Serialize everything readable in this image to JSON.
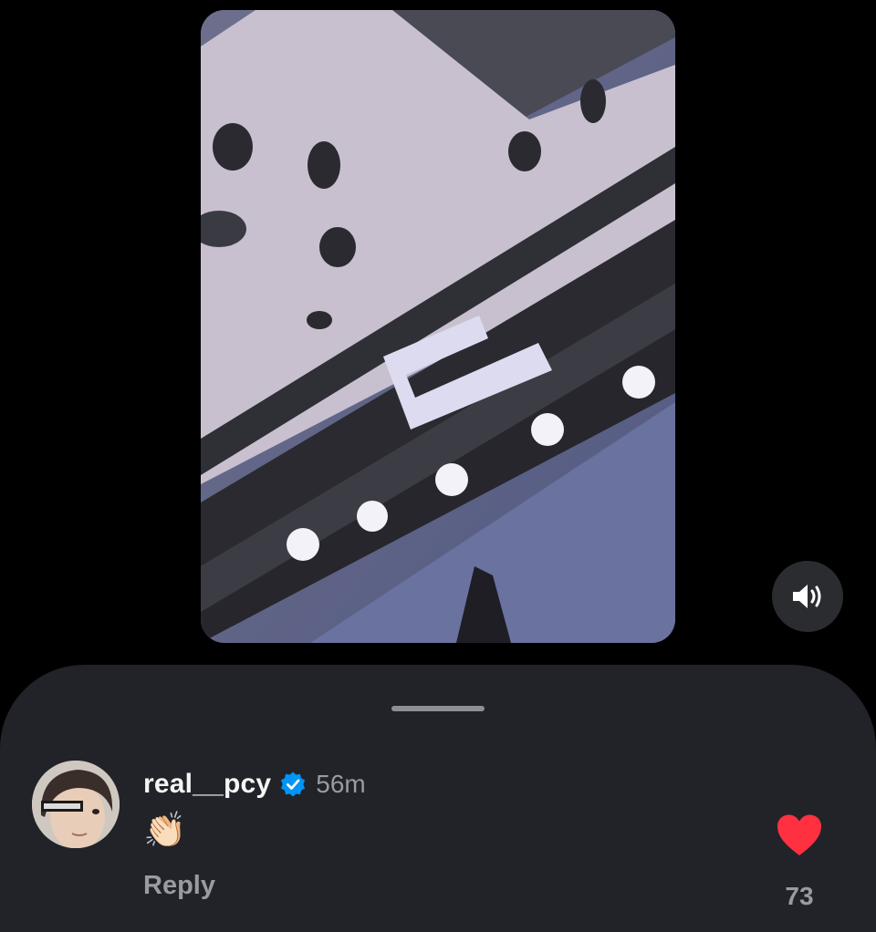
{
  "media": {
    "icon": "video-preview"
  },
  "controls": {
    "sound_icon": "speaker-volume-icon"
  },
  "comment": {
    "username": "real__pcy",
    "verified": true,
    "timestamp": "56m",
    "text": "👏🏻",
    "reply_label": "Reply",
    "liked": true,
    "like_count": "73"
  },
  "colors": {
    "sheet_background": "#222329",
    "like_red": "#ff3040",
    "verified_blue": "#0095f6",
    "muted_text": "#9a9ba1"
  }
}
